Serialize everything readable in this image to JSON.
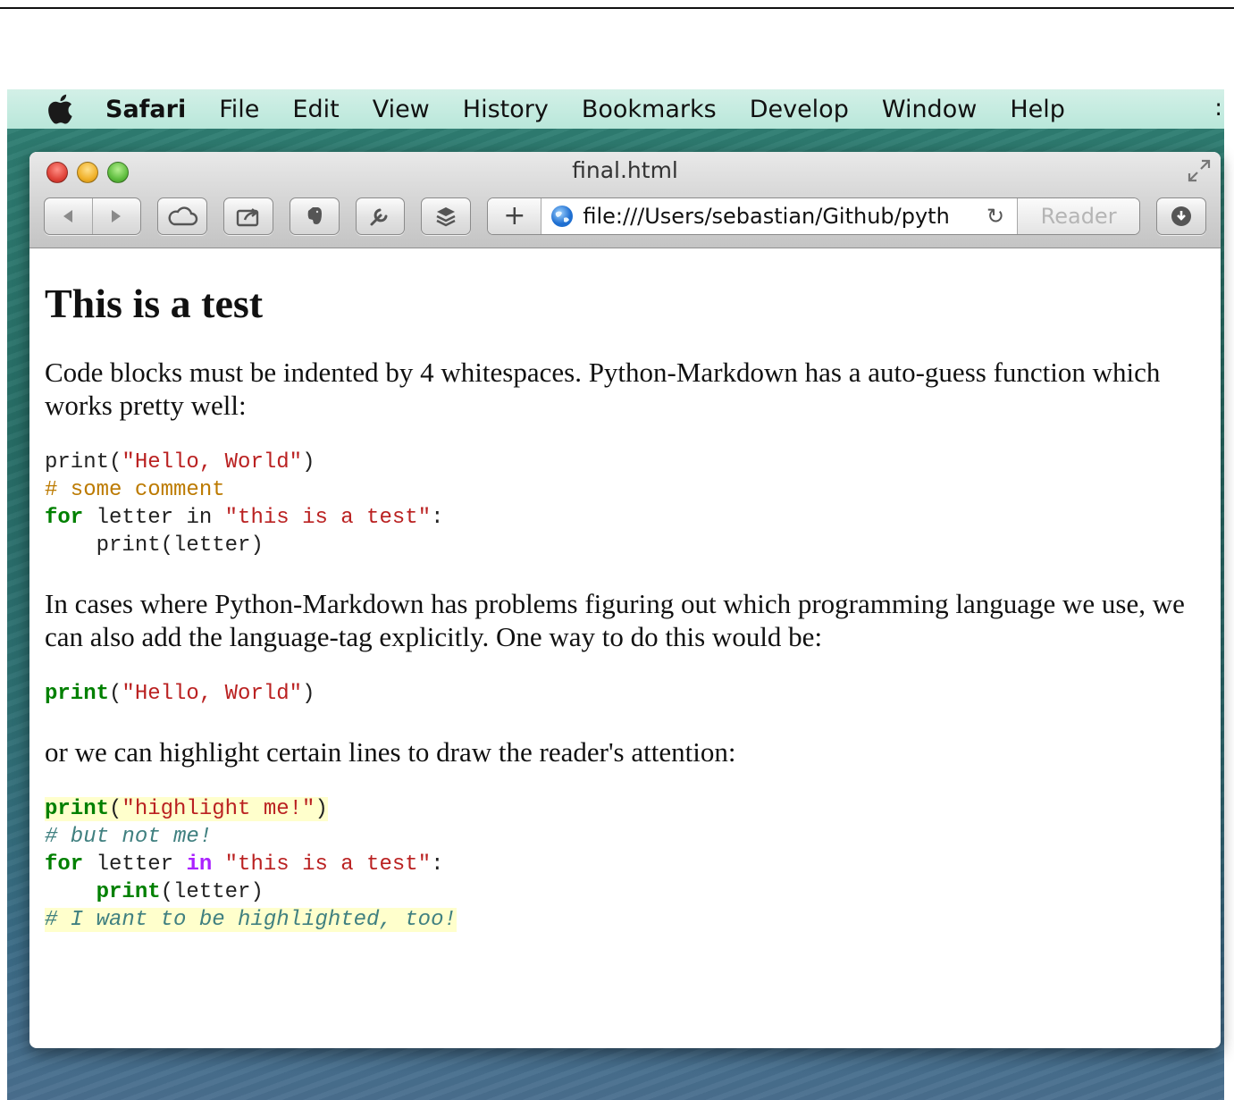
{
  "menubar": {
    "app_name": "Safari",
    "items": [
      "File",
      "Edit",
      "View",
      "History",
      "Bookmarks",
      "Develop",
      "Window",
      "Help"
    ]
  },
  "window": {
    "title": "final.html",
    "address_url": "file:///Users/sebastian/Github/pyth",
    "reader_label": "Reader"
  },
  "page": {
    "heading": "This is a test",
    "para1": "Code blocks must be indented by 4 whitespaces. Python-Markdown has a auto-guess function which works pretty well:",
    "code1": {
      "line1_fn": "print(",
      "line1_str": "\"Hello, World\"",
      "line1_close": ")",
      "line2_comment": "# some comment",
      "line3_kw": "for",
      "line3_mid": " letter in ",
      "line3_str": "\"this is a test\"",
      "line3_end": ":",
      "line4": "    print(letter)"
    },
    "para2": "In cases where Python-Markdown has problems figuring out which programming language we use, we can also add the language-tag explicitly. One way to do this would be:",
    "code2": {
      "fn": "print",
      "open": "(",
      "str": "\"Hello, World\"",
      "close": ")"
    },
    "para3": "or we can highlight certain lines to draw the reader's attention:",
    "code3": {
      "line1_fn": "print",
      "line1_open": "(",
      "line1_str": "\"highlight me!\"",
      "line1_close": ")",
      "line2_comment": "# but not me!",
      "line3_kw": "for",
      "line3_var": " letter ",
      "line3_in": "in",
      "line3_sp": " ",
      "line3_str": "\"this is a test\"",
      "line3_end": ":",
      "line4_indent": "    ",
      "line4_fn": "print",
      "line4_rest": "(letter)",
      "line5_comment": "# I want to be highlighted, too!"
    }
  },
  "colors": {
    "keyword": "#008000",
    "string": "#ba2121",
    "comment": "#408080",
    "highlight": "#ffffcc"
  }
}
